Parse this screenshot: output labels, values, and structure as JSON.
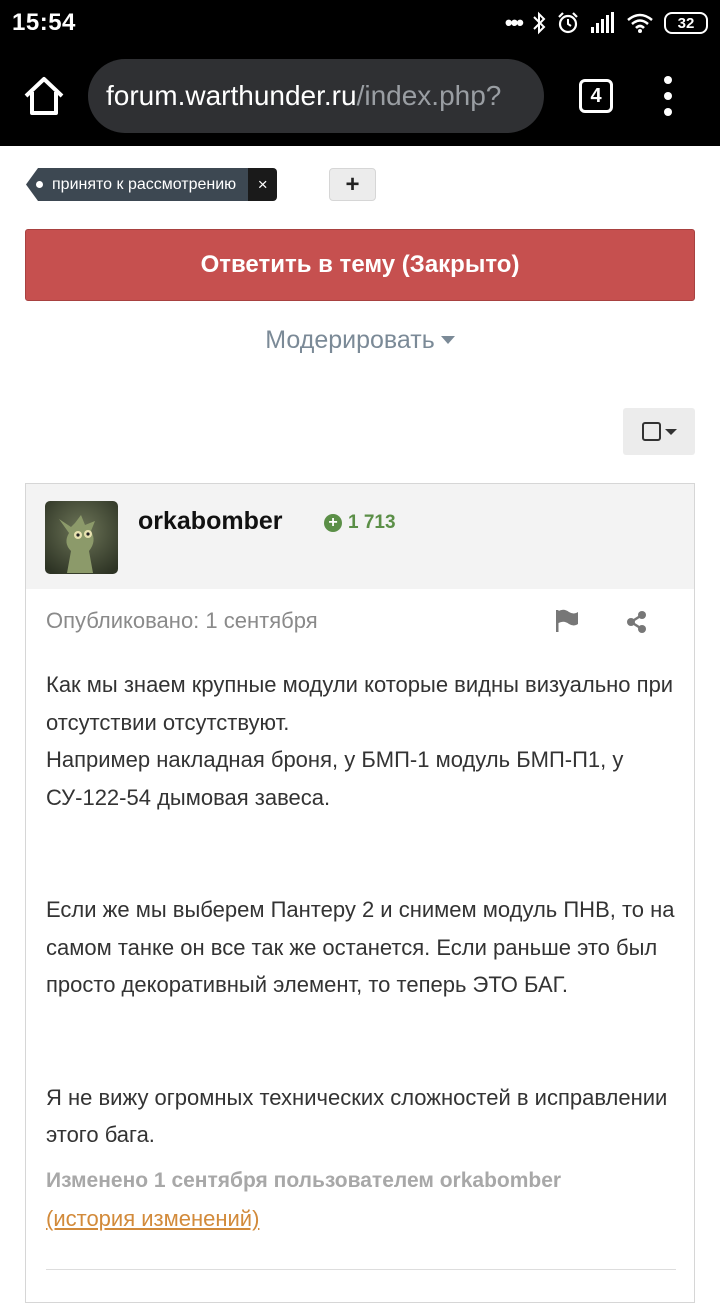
{
  "status_bar": {
    "time": "15:54",
    "battery": "32"
  },
  "browser": {
    "url_host": "forum.warthunder.ru",
    "url_path": "/index.php?",
    "tab_count": "4"
  },
  "tag": {
    "label": "принято к рассмотрению",
    "remove": "×",
    "add": "+"
  },
  "reply_button": "Ответить в тему (Закрыто)",
  "moderate_label": "Модерировать",
  "post": {
    "author": "orkabomber",
    "reputation": "1 713",
    "posted": "Опубликовано: 1 сентября",
    "paragraphs": [
      "Как мы знаем крупные модули которые видны визуально при отсутствии отсутствуют.",
      "Например накладная броня, у БМП-1 модуль БМП-П1, у СУ-122-54 дымовая завеса.",
      "Если же мы выберем Пантеру 2 и снимем модуль ПНВ, то на самом танке он все так же останется. Если раньше это был просто декоративный элемент, то теперь ЭТО БАГ.",
      "Я не вижу огромных технических сложностей в исправлении этого бага."
    ],
    "edited": "Изменено 1 сентября пользователем orkabomber",
    "history_link": "(история изменений)"
  },
  "colors": {
    "reply_button": "#c6504f",
    "reputation": "#5b8f47",
    "link": "#d28a3a"
  }
}
